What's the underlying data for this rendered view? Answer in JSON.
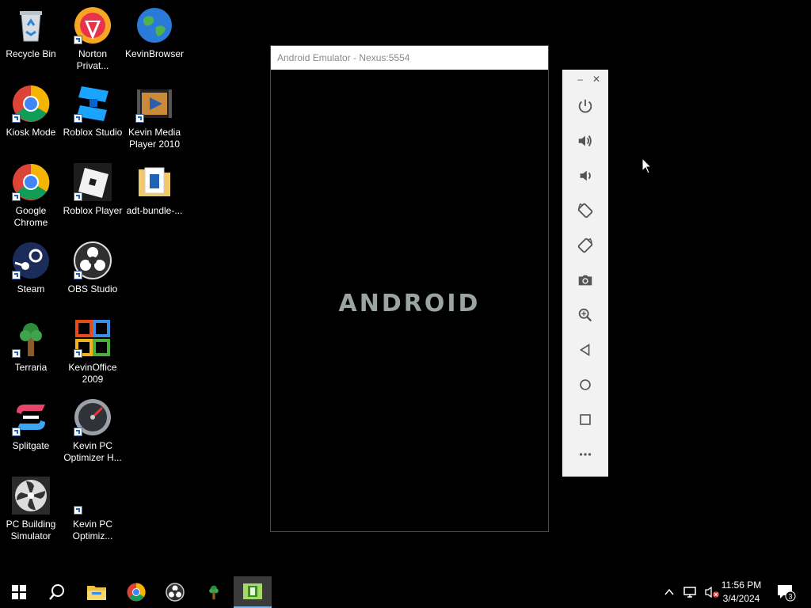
{
  "desktop_icons": [
    {
      "label": "Recycle Bin"
    },
    {
      "label": "Norton Privat..."
    },
    {
      "label": "KevinBrowser"
    },
    {
      "label": "Kiosk Mode"
    },
    {
      "label": "Roblox Studio"
    },
    {
      "label": "Kevin Media Player 2010"
    },
    {
      "label": "Google Chrome"
    },
    {
      "label": "Roblox Player"
    },
    {
      "label": "adt-bundle-..."
    },
    {
      "label": "Steam"
    },
    {
      "label": "OBS Studio"
    },
    {
      "label": "Terraria"
    },
    {
      "label": "KevinOffice 2009"
    },
    {
      "label": "Splitgate"
    },
    {
      "label": "Kevin PC Optimizer H..."
    },
    {
      "label": "PC Building Simulator"
    },
    {
      "label": "Kevin PC Optimiz..."
    }
  ],
  "emulator": {
    "title": "Android Emulator - Nexus:5554",
    "boot_text": "ANDROID"
  },
  "emulator_toolbar": {
    "minimize_label": "–",
    "close_label": "✕",
    "buttons": [
      "power-icon",
      "volume-up-icon",
      "volume-down-icon",
      "rotate-left-icon",
      "rotate-right-icon",
      "camera-icon",
      "zoom-icon",
      "back-icon",
      "home-icon",
      "overview-icon",
      "more-icon"
    ]
  },
  "taskbar": {
    "items": [
      "start-icon",
      "search-icon",
      "file-explorer-icon",
      "chrome-icon",
      "obs-icon",
      "terraria-icon",
      "android-emulator-icon"
    ],
    "time": "11:56 PM",
    "date": "3/4/2024",
    "notification_count": "3"
  }
}
